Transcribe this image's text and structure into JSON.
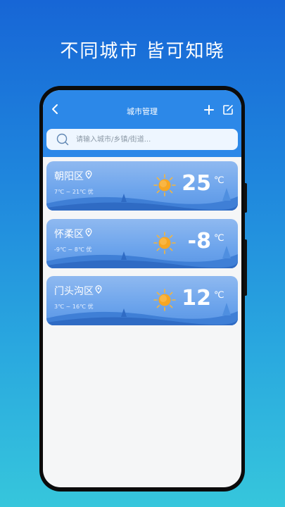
{
  "promo": {
    "headline": "不同城市  皆可知晓"
  },
  "header": {
    "title": "城市管理",
    "back_icon": "chevron-left-icon",
    "add_icon": "plus-icon",
    "edit_icon": "edit-icon"
  },
  "search": {
    "placeholder": "请输入城市/乡镇/街道..."
  },
  "cities": [
    {
      "name": "朝阳区",
      "range": "7℃ ~ 21℃  优",
      "temp": "25",
      "unit": "℃"
    },
    {
      "name": "怀柔区",
      "range": "-9℃ ~ 8℃  优",
      "temp": "-8",
      "unit": "℃"
    },
    {
      "name": "门头沟区",
      "range": "3℃ ~ 16℃  优",
      "temp": "12",
      "unit": "℃"
    }
  ],
  "colors": {
    "accent": "#2c88e8",
    "card": "#6ca4ec",
    "sun": "#f6a623"
  }
}
